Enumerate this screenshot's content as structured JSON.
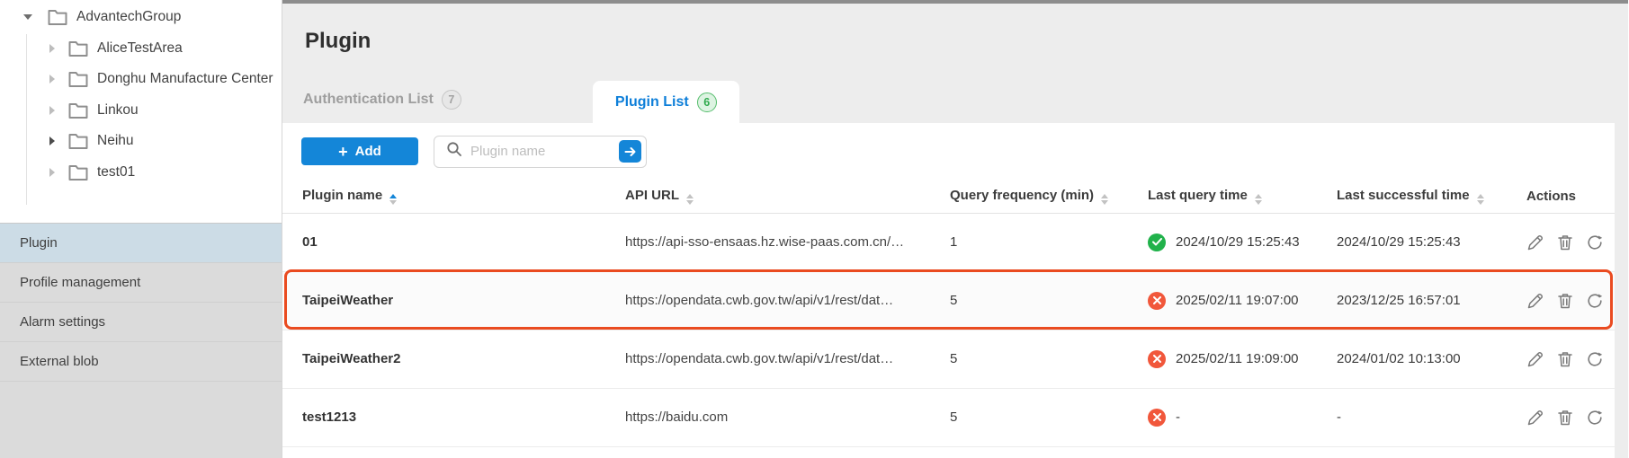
{
  "sidebar": {
    "tree": {
      "root": {
        "label": "AdvantechGroup"
      },
      "children": [
        {
          "label": "AliceTestArea"
        },
        {
          "label": "Donghu Manufacture Center"
        },
        {
          "label": "Linkou"
        },
        {
          "label": "Neihu"
        },
        {
          "label": "test01"
        }
      ]
    },
    "menu": [
      {
        "label": "Plugin"
      },
      {
        "label": "Profile management"
      },
      {
        "label": "Alarm settings"
      },
      {
        "label": "External blob"
      }
    ]
  },
  "header": {
    "title": "Plugin",
    "tabs": [
      {
        "label": "Authentication List",
        "badge": "7"
      },
      {
        "label": "Plugin List",
        "badge": "6"
      }
    ]
  },
  "toolbar": {
    "add_icon": "+",
    "add_label": "Add",
    "search_placeholder": "Plugin name"
  },
  "table": {
    "columns": [
      "Plugin name",
      "API URL",
      "Query frequency (min)",
      "Last query time",
      "Last successful time",
      "Actions"
    ],
    "rows": [
      {
        "name": "01",
        "url": "https://api-sso-ensaas.hz.wise-paas.com.cn/…",
        "freq": "1",
        "status": "success",
        "last_query": "2024/10/29 15:25:43",
        "last_success": "2024/10/29 15:25:43"
      },
      {
        "name": "TaipeiWeather",
        "url": "https://opendata.cwb.gov.tw/api/v1/rest/dat…",
        "freq": "5",
        "status": "error",
        "last_query": "2025/02/11 19:07:00",
        "last_success": "2023/12/25 16:57:01",
        "highlighted": true
      },
      {
        "name": "TaipeiWeather2",
        "url": "https://opendata.cwb.gov.tw/api/v1/rest/dat…",
        "freq": "5",
        "status": "error",
        "last_query": "2025/02/11 19:09:00",
        "last_success": "2024/01/02 10:13:00"
      },
      {
        "name": "test1213",
        "url": "https://baidu.com",
        "freq": "5",
        "status": "error",
        "last_query": "-",
        "last_success": "-"
      }
    ]
  },
  "colors": {
    "accent_blue": "#1486d8",
    "tab_active_blue": "#0e7fd9",
    "success_green": "#21b24b",
    "error_red": "#f1573b",
    "highlight_border": "#ea4b20",
    "selected_menu_bg": "#ccdce6"
  }
}
